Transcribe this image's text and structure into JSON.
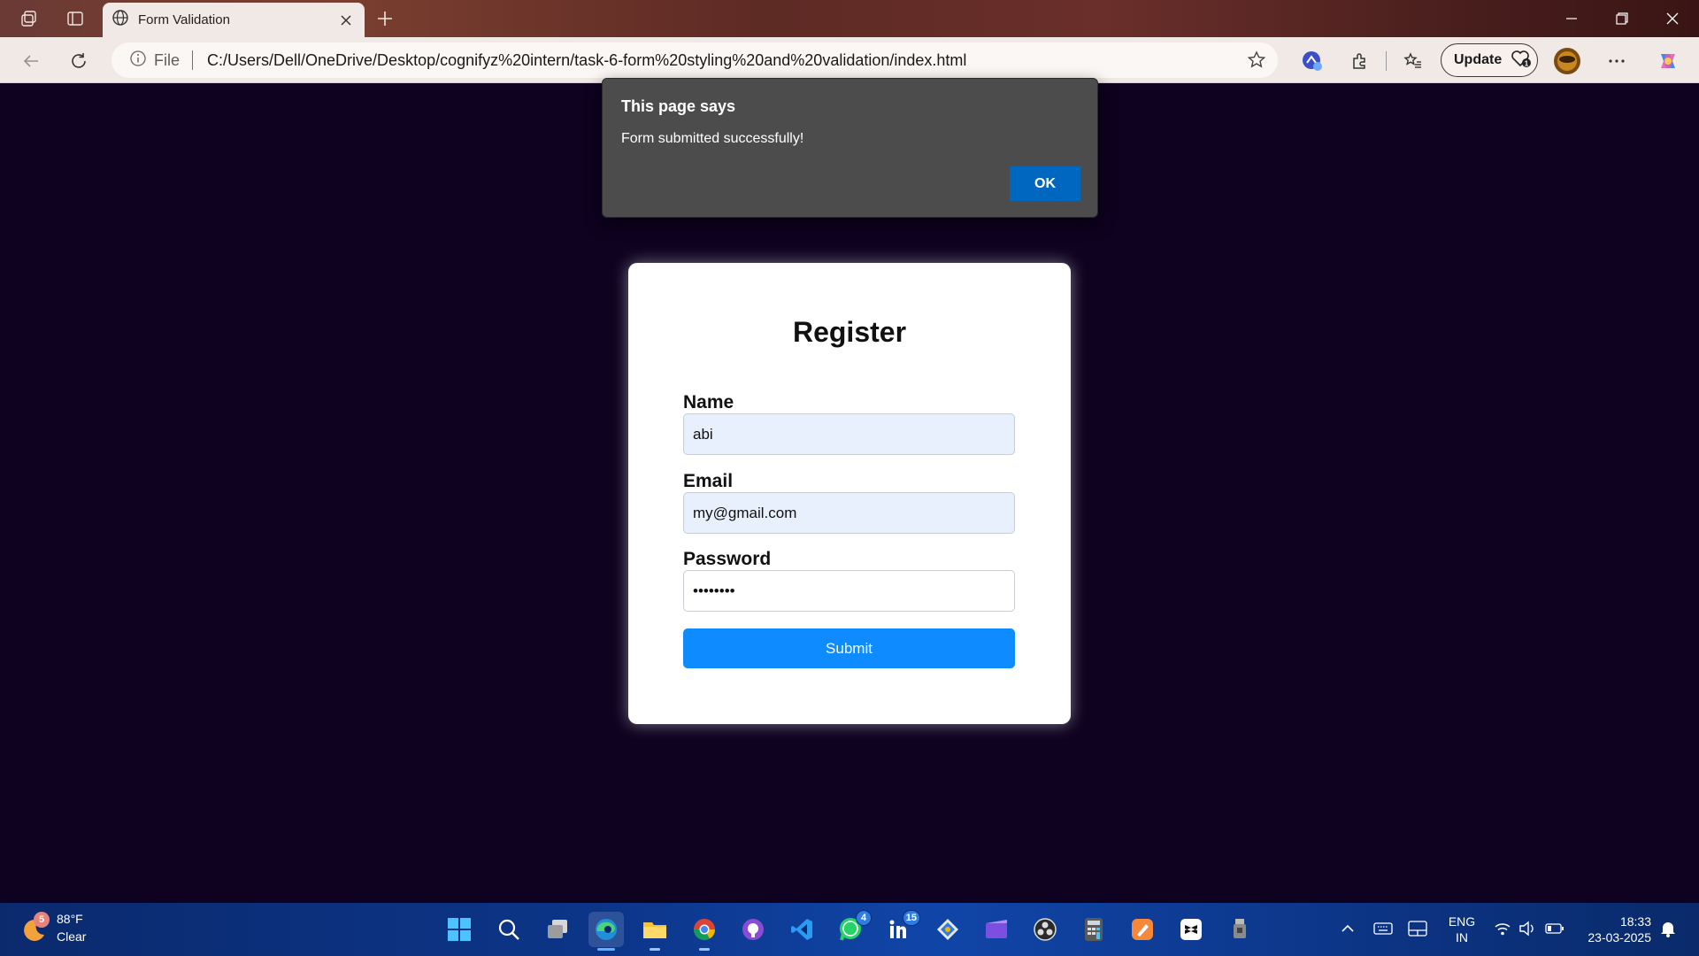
{
  "browser": {
    "tab_title": "Form Validation",
    "address": {
      "scheme_label": "File",
      "url": "C:/Users/Dell/OneDrive/Desktop/cognifyz%20intern/task-6-form%20styling%20and%20validation/index.html"
    },
    "update_label": "Update"
  },
  "dialog": {
    "title": "This page says",
    "message": "Form submitted successfully!",
    "ok_label": "OK"
  },
  "form": {
    "heading": "Register",
    "name": {
      "label": "Name",
      "value": "abi"
    },
    "email": {
      "label": "Email",
      "value": "my@gmail.com"
    },
    "password": {
      "label": "Password",
      "masked_value": "••••••••"
    },
    "submit_label": "Submit"
  },
  "taskbar": {
    "weather": {
      "badge": "5",
      "temp": "88°F",
      "condition": "Clear"
    },
    "badges": {
      "whatsapp": "4",
      "linkedin": "15"
    },
    "language": {
      "line1": "ENG",
      "line2": "IN"
    },
    "clock": {
      "time": "18:33",
      "date": "23-03-2025"
    }
  }
}
